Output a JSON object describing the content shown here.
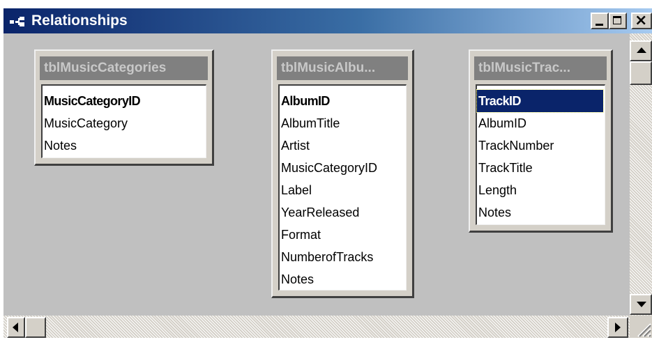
{
  "window": {
    "title": "Relationships",
    "icon": "relationships-icon"
  },
  "title_buttons": {
    "minimize": "minimize-icon",
    "maximize": "maximize-icon",
    "close": "close-icon",
    "close_glyph": "×"
  },
  "tables": [
    {
      "name": "tblMusicCategories",
      "title_display": "tblMusicCategories",
      "fields": [
        {
          "label": "MusicCategoryID",
          "primary_key": true
        },
        {
          "label": "MusicCategory",
          "primary_key": false
        },
        {
          "label": "Notes",
          "primary_key": false
        }
      ]
    },
    {
      "name": "tblMusicAlbums",
      "title_display": "tblMusicAlbu...",
      "fields": [
        {
          "label": "AlbumID",
          "primary_key": true
        },
        {
          "label": "AlbumTitle",
          "primary_key": false
        },
        {
          "label": "Artist",
          "primary_key": false
        },
        {
          "label": "MusicCategoryID",
          "primary_key": false
        },
        {
          "label": "Label",
          "primary_key": false
        },
        {
          "label": "YearReleased",
          "primary_key": false
        },
        {
          "label": "Format",
          "primary_key": false
        },
        {
          "label": "NumberofTracks",
          "primary_key": false
        },
        {
          "label": "Notes",
          "primary_key": false
        }
      ]
    },
    {
      "name": "tblMusicTracks",
      "title_display": "tblMusicTrac...",
      "fields": [
        {
          "label": "TrackID",
          "primary_key": true,
          "selected": true
        },
        {
          "label": "AlbumID",
          "primary_key": false
        },
        {
          "label": "TrackNumber",
          "primary_key": false
        },
        {
          "label": "TrackTitle",
          "primary_key": false
        },
        {
          "label": "Length",
          "primary_key": false
        },
        {
          "label": "Notes",
          "primary_key": false
        }
      ]
    }
  ],
  "colors": {
    "titlebar_start": "#0a246a",
    "titlebar_end": "#a6caf0",
    "workspace": "#c0c0c0",
    "selection": "#0a246a"
  },
  "scrollbars": {
    "up": "scroll-up-arrow-icon",
    "down": "scroll-down-arrow-icon",
    "left": "scroll-left-arrow-icon",
    "right": "scroll-right-arrow-icon"
  }
}
